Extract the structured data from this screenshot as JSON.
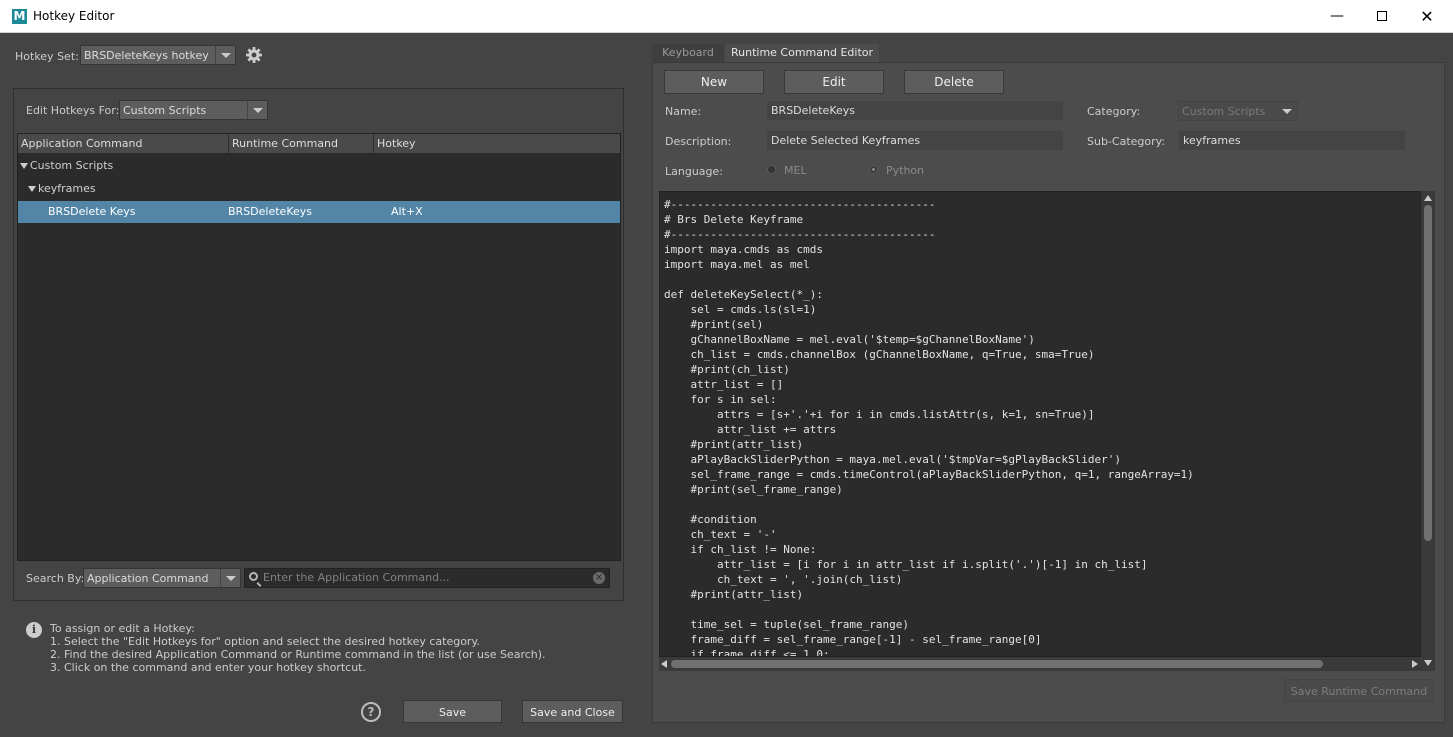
{
  "window": {
    "title": "Hotkey Editor",
    "icon_letter": "M"
  },
  "hotkey_set": {
    "label": "Hotkey Set:",
    "value": "BRSDeleteKeys hotkey"
  },
  "edit_for": {
    "label": "Edit Hotkeys For:",
    "value": "Custom Scripts"
  },
  "table": {
    "headers": [
      "Application Command",
      "Runtime Command",
      "Hotkey"
    ],
    "rows": [
      {
        "app": "Custom Scripts",
        "runtime": "",
        "hotkey": ""
      },
      {
        "app": "keyframes",
        "runtime": "",
        "hotkey": ""
      },
      {
        "app": "BRSDelete Keys",
        "runtime": "BRSDeleteKeys",
        "hotkey": "Alt+X"
      }
    ]
  },
  "search": {
    "label": "Search By:",
    "mode": "Application Command",
    "placeholder": "Enter the Application Command..."
  },
  "help": {
    "title": "To assign or edit a Hotkey:",
    "steps": [
      "1. Select the \"Edit Hotkeys for\" option and select the desired hotkey category.",
      "2. Find the desired Application Command or Runtime command in the list (or use Search).",
      "3. Click on the command and enter your hotkey shortcut."
    ]
  },
  "bottom": {
    "save": "Save",
    "save_close": "Save and Close",
    "help_glyph": "?"
  },
  "tabs": [
    "Keyboard",
    "Runtime Command Editor"
  ],
  "rce": {
    "new": "New",
    "edit": "Edit",
    "delete": "Delete",
    "name_label": "Name:",
    "name_value": "BRSDeleteKeys",
    "desc_label": "Description:",
    "desc_value": "Delete Selected Keyframes",
    "cat_label": "Category:",
    "cat_value": "Custom Scripts",
    "subcat_label": "Sub-Category:",
    "subcat_value": "keyframes",
    "lang_label": "Language:",
    "lang_mel": "MEL",
    "lang_python": "Python",
    "save_rc": "Save Runtime Command"
  },
  "code": "#----------------------------------------\n# Brs Delete Keyframe\n#----------------------------------------\nimport maya.cmds as cmds\nimport maya.mel as mel\n\ndef deleteKeySelect(*_):\n    sel = cmds.ls(sl=1)\n    #print(sel)\n    gChannelBoxName = mel.eval('$temp=$gChannelBoxName')\n    ch_list = cmds.channelBox (gChannelBoxName, q=True, sma=True)\n    #print(ch_list)\n    attr_list = []\n    for s in sel:\n        attrs = [s+'.'+i for i in cmds.listAttr(s, k=1, sn=True)]\n        attr_list += attrs\n    #print(attr_list)\n    aPlayBackSliderPython = maya.mel.eval('$tmpVar=$gPlayBackSlider')\n    sel_frame_range = cmds.timeControl(aPlayBackSliderPython, q=1, rangeArray=1)\n    #print(sel_frame_range)\n\n    #condition\n    ch_text = '-'\n    if ch_list != None:\n        attr_list = [i for i in attr_list if i.split('.')[-1] in ch_list]\n        ch_text = ', '.join(ch_list)\n    #print(attr_list)\n\n    time_sel = tuple(sel_frame_range)\n    frame_diff = sel_frame_range[-1] - sel_frame_range[0]\n    if frame_diff <= 1.0:"
}
